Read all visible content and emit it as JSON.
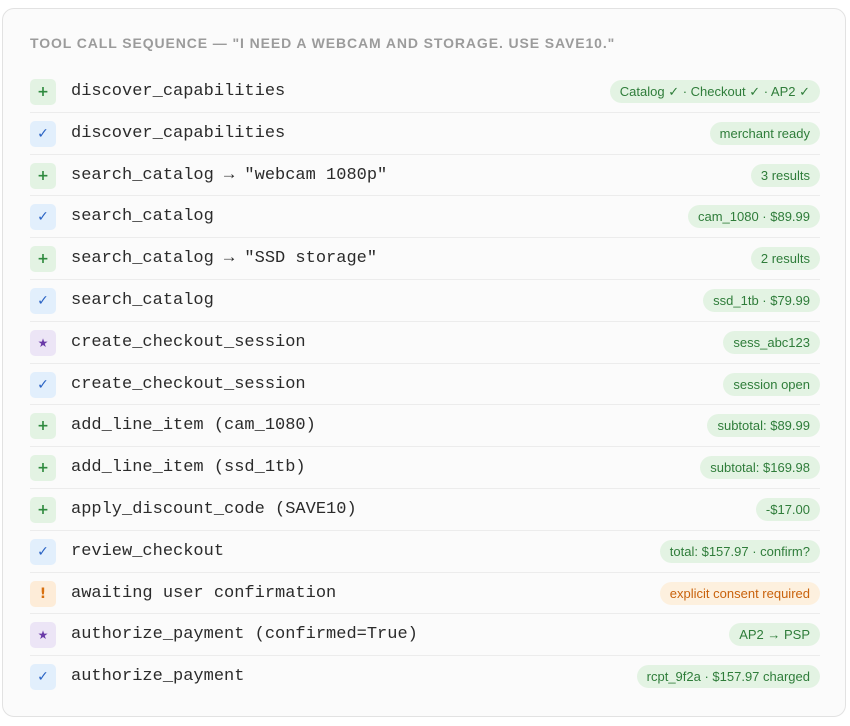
{
  "header": {
    "title": "TOOL CALL SEQUENCE — \"I NEED A WEBCAM AND STORAGE. USE SAVE10.\""
  },
  "colors": {
    "plus_bg": "#e3f3e3",
    "check_bg": "#e2effc",
    "star_bg": "#ece5f6",
    "warn_bg": "#fdecd8",
    "badge_ok_text": "#2f7d3a",
    "badge_warn_text": "#c9620c"
  },
  "rows": [
    {
      "icon": "+",
      "icon_name": "plus-icon",
      "label": "discover_capabilities",
      "badge": "Catalog ✓ · Checkout ✓ · AP2 ✓"
    },
    {
      "icon": "✓",
      "icon_name": "check-icon",
      "label": "discover_capabilities",
      "badge": "merchant ready"
    },
    {
      "icon": "+",
      "icon_name": "plus-icon",
      "label": "search_catalog → \"webcam 1080p\"",
      "badge": "3 results"
    },
    {
      "icon": "✓",
      "icon_name": "check-icon",
      "label": "search_catalog",
      "badge": "cam_1080 · $89.99"
    },
    {
      "icon": "+",
      "icon_name": "plus-icon",
      "label": "search_catalog → \"SSD storage\"",
      "badge": "2 results"
    },
    {
      "icon": "✓",
      "icon_name": "check-icon",
      "label": "search_catalog",
      "badge": "ssd_1tb · $79.99"
    },
    {
      "icon": "★",
      "icon_name": "star-icon",
      "label": "create_checkout_session",
      "badge": "sess_abc123"
    },
    {
      "icon": "✓",
      "icon_name": "check-icon",
      "label": "create_checkout_session",
      "badge": "session open"
    },
    {
      "icon": "+",
      "icon_name": "plus-icon",
      "label": "add_line_item (cam_1080)",
      "badge": "subtotal: $89.99"
    },
    {
      "icon": "+",
      "icon_name": "plus-icon",
      "label": "add_line_item (ssd_1tb)",
      "badge": "subtotal: $169.98"
    },
    {
      "icon": "+",
      "icon_name": "plus-icon",
      "label": "apply_discount_code (SAVE10)",
      "badge": "-$17.00"
    },
    {
      "icon": "✓",
      "icon_name": "check-icon",
      "label": "review_checkout",
      "badge": "total: $157.97 · confirm?"
    },
    {
      "icon": "!",
      "icon_name": "warning-icon",
      "label": "awaiting user confirmation",
      "badge": "explicit consent required"
    },
    {
      "icon": "★",
      "icon_name": "star-icon",
      "label": "authorize_payment (confirmed=True)",
      "badge": "AP2 → PSP"
    },
    {
      "icon": "✓",
      "icon_name": "check-icon",
      "label": "authorize_payment",
      "badge": "rcpt_9f2a · $157.97 charged"
    }
  ]
}
